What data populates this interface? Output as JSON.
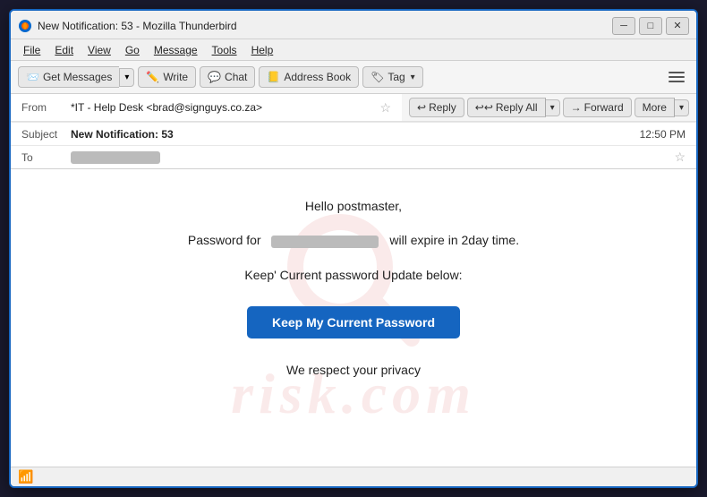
{
  "window": {
    "title": "New Notification: 53 - Mozilla Thunderbird",
    "icon": "thunderbird"
  },
  "titlebar": {
    "minimize_label": "─",
    "maximize_label": "□",
    "close_label": "✕"
  },
  "menubar": {
    "items": [
      "File",
      "Edit",
      "View",
      "Go",
      "Message",
      "Tools",
      "Help"
    ]
  },
  "toolbar": {
    "get_messages_label": "Get Messages",
    "write_label": "Write",
    "chat_label": "Chat",
    "address_book_label": "Address Book",
    "tag_label": "Tag",
    "menu_label": "☰"
  },
  "email_header": {
    "from_label": "From",
    "from_value": "*IT - Help Desk <brad@signguys.co.za>",
    "subject_label": "Subject",
    "subject_value": "New Notification: 53",
    "to_label": "To",
    "to_value": "",
    "time": "12:50 PM",
    "reply_label": "Reply",
    "reply_all_label": "Reply All",
    "forward_label": "Forward",
    "more_label": "More"
  },
  "email_body": {
    "greeting": "Hello postmaster,",
    "body_line1_prefix": "Password for",
    "body_line1_suffix": "will expire in 2day time.",
    "body_line2": "Keep' Current password Update below:",
    "cta_button": "Keep My Current Password",
    "footer": "We respect your privacy"
  },
  "watermark": {
    "text": "risk.com"
  },
  "statusbar": {
    "connection_icon": "📶"
  }
}
